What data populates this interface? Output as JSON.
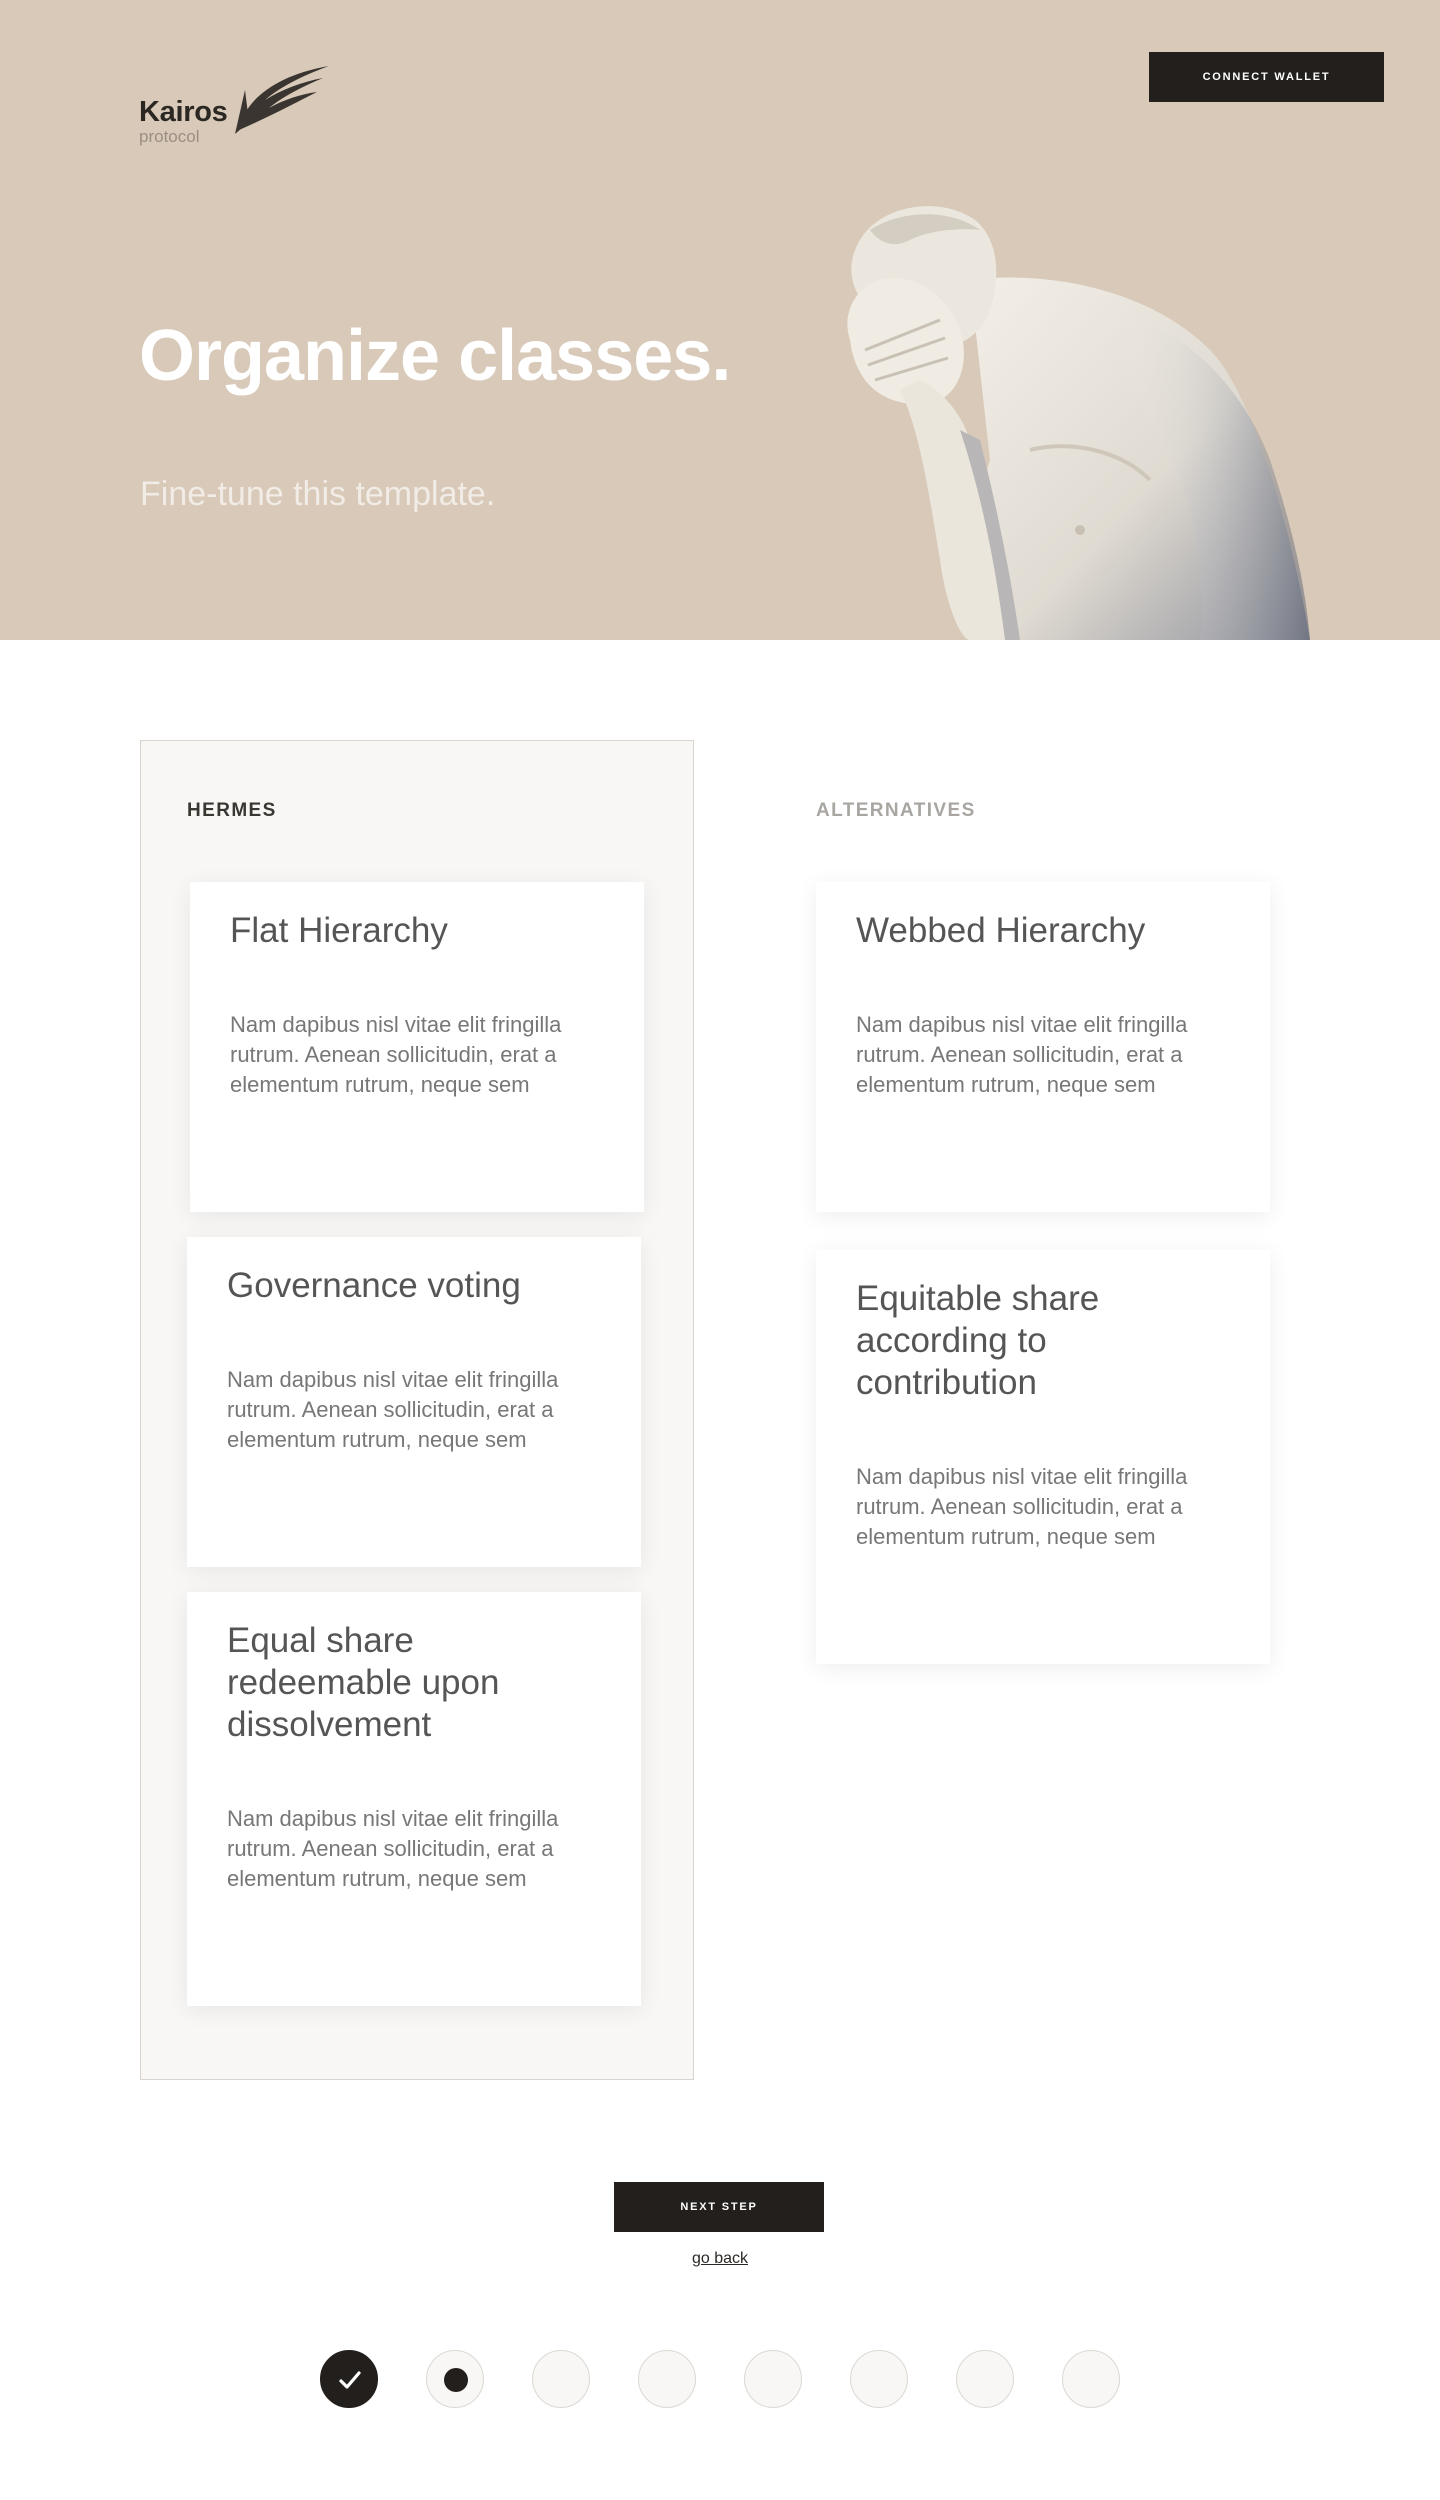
{
  "header": {
    "logo_name": "Kairos",
    "logo_sub": "protocol",
    "connect_label": "CONNECT WALLET"
  },
  "hero": {
    "title": "Organize classes.",
    "subtitle": "Fine-tune this template."
  },
  "columns": {
    "selected_label": "HERMES",
    "alternatives_label": "ALTERNATIVES"
  },
  "cards": [
    {
      "title": "Flat Hierarchy",
      "body": "Nam dapibus nisl vitae elit fringilla rutrum. Aenean sollicitudin, erat a elementum rutrum, neque sem"
    },
    {
      "title": "Governance voting",
      "body": "Nam dapibus nisl vitae elit fringilla rutrum. Aenean sollicitudin, erat a elementum rutrum, neque sem"
    },
    {
      "title": "Equal share redeemable upon dissolvement",
      "body": "Nam dapibus nisl vitae elit fringilla rutrum. Aenean sollicitudin, erat a elementum rutrum, neque sem"
    },
    {
      "title": "Webbed Hierarchy",
      "body": "Nam dapibus nisl vitae elit fringilla rutrum. Aenean sollicitudin, erat a elementum rutrum, neque sem"
    },
    {
      "title": "Equitable share according to contribution",
      "body": "Nam dapibus nisl vitae elit fringilla rutrum. Aenean sollicitudin, erat a elementum rutrum, neque sem"
    }
  ],
  "actions": {
    "next_label": "NEXT STEP",
    "back_label": "go back"
  },
  "steps": {
    "total": 8,
    "completed": 1,
    "current": 2
  },
  "colors": {
    "hero_bg": "#d8c9b8",
    "button_bg": "#221f1c",
    "panel_bg": "#f8f7f5"
  }
}
